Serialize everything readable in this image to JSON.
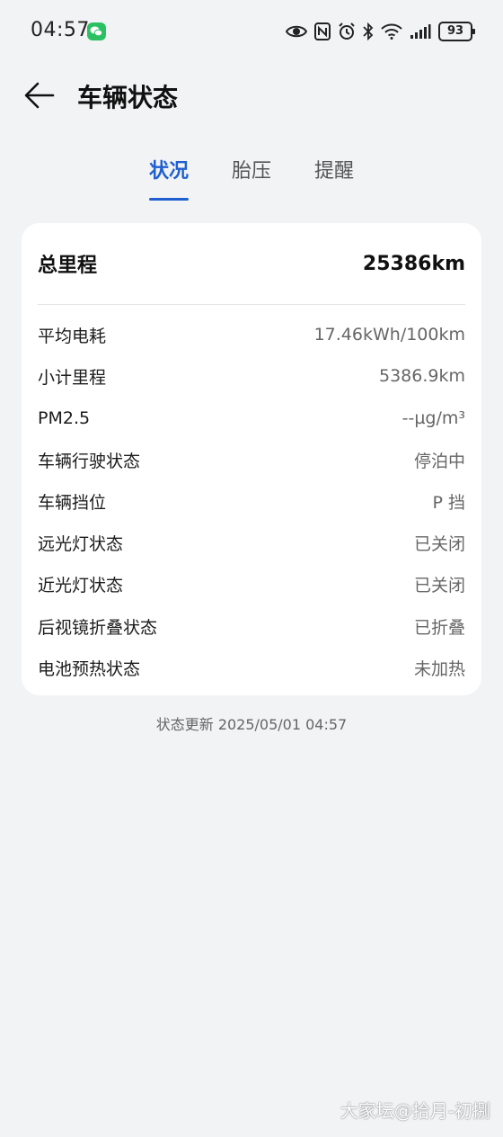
{
  "status_bar": {
    "time": "04:57",
    "battery_level": "93"
  },
  "header": {
    "title": "车辆状态"
  },
  "tabs": [
    {
      "label": "状况",
      "active": true
    },
    {
      "label": "胎压",
      "active": false
    },
    {
      "label": "提醒",
      "active": false
    }
  ],
  "summary": {
    "label": "总里程",
    "value": "25386km"
  },
  "rows": [
    {
      "label": "平均电耗",
      "value": "17.46kWh/100km"
    },
    {
      "label": "小计里程",
      "value": "5386.9km"
    },
    {
      "label": "PM2.5",
      "value": "--µg/m³"
    },
    {
      "label": "车辆行驶状态",
      "value": "停泊中"
    },
    {
      "label": "车辆挡位",
      "value": "P 挡"
    },
    {
      "label": "远光灯状态",
      "value": "已关闭"
    },
    {
      "label": "近光灯状态",
      "value": "已关闭"
    },
    {
      "label": "后视镜折叠状态",
      "value": "已折叠"
    },
    {
      "label": "电池预热状态",
      "value": "未加热"
    }
  ],
  "update_time": "状态更新 2025/05/01 04:57",
  "watermark": "大家坛@拾月-初捌",
  "colors": {
    "accent": "#1f5fd0",
    "background": "#f1f3f5",
    "card": "#ffffff",
    "wechat_green": "#2bc162"
  },
  "icons": [
    "back-arrow-icon",
    "wechat-icon",
    "eye-icon",
    "nfc-icon",
    "alarm-icon",
    "bluetooth-icon",
    "wifi-icon",
    "signal-icon",
    "battery-icon"
  ]
}
